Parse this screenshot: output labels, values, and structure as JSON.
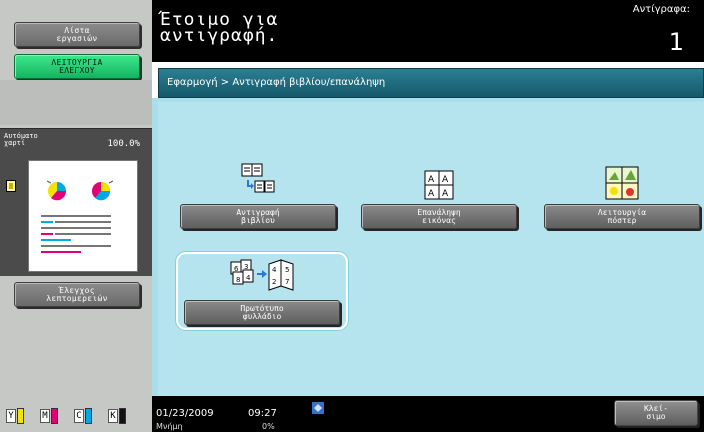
{
  "left_panel": {
    "job_list_button": [
      "Λίστα",
      "εργασιών"
    ],
    "function_check_button": [
      "ΛΕΙΤΟΥΡΓΙΑ",
      "ΕΛΕΓΧΟΥ"
    ],
    "auto_paper_label": [
      "Αυτόματο",
      "χαρτί"
    ],
    "zoom_value": "100.0%",
    "detail_check_button": [
      "Έλεγχος",
      "λεπτομερειών"
    ],
    "ink_levels": [
      {
        "label": "Y",
        "color": "#f4e300",
        "level": 0.9
      },
      {
        "label": "M",
        "color": "#e0007a",
        "level": 0.9
      },
      {
        "label": "C",
        "color": "#00a9e6",
        "level": 0.9
      },
      {
        "label": "K",
        "color": "#111111",
        "level": 0.9
      }
    ]
  },
  "header": {
    "status_text": "Έτοιμο για\nαντιγραφή.",
    "copies_label": "Αντίγραφα:",
    "copies_value": "1"
  },
  "breadcrumb": "Εφαρμογή > Αντιγραφή βιβλίου/επανάληψη",
  "functions": {
    "book_copy": {
      "label": [
        "Αντιγραφή",
        "βιβλίου"
      ],
      "icon": "book-copy-icon"
    },
    "image_repeat": {
      "label": [
        "Επανάληψη",
        "εικόνας"
      ],
      "icon": "image-repeat-icon"
    },
    "poster": {
      "label": [
        "Λειτουργία",
        "πόστερ"
      ],
      "icon": "poster-mode-icon"
    },
    "booklet_original": {
      "label": [
        "Πρωτότυπο",
        "φυλλάδιο"
      ],
      "icon": "booklet-original-icon"
    }
  },
  "footer": {
    "date": "01/23/2009",
    "time": "09:27",
    "memory_label": "Μνήμη",
    "memory_value": "0%",
    "close_button": [
      "Κλεί-",
      "σιμο"
    ]
  },
  "colors": {
    "accent_green": "#14b560",
    "breadcrumb_teal": "#1f6d80",
    "content_bg": "#b5e4ee"
  }
}
